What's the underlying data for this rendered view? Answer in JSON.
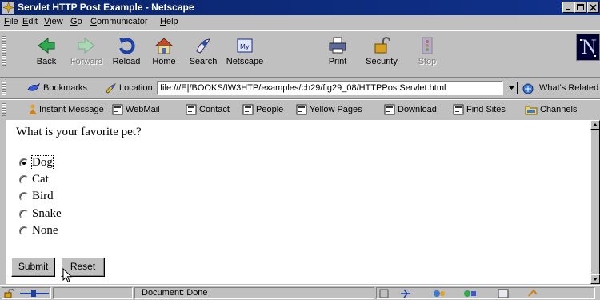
{
  "window": {
    "title": "Servlet HTTP Post Example - Netscape",
    "icon": "netscape-star-icon"
  },
  "menu": {
    "items": [
      {
        "label": "File",
        "accel": "F",
        "rest": "ile"
      },
      {
        "label": "Edit",
        "accel": "E",
        "rest": "dit"
      },
      {
        "label": "View",
        "accel": "V",
        "rest": "iew"
      },
      {
        "label": "Go",
        "accel": "G",
        "rest": "o"
      },
      {
        "label": "Communicator",
        "accel": "C",
        "rest": "ommunicator"
      },
      {
        "label": "Help",
        "accel": "H",
        "rest": "elp"
      }
    ]
  },
  "toolbar": {
    "back": "Back",
    "forward": "Forward",
    "reload": "Reload",
    "home": "Home",
    "search": "Search",
    "netscape": "Netscape",
    "print": "Print",
    "security": "Security",
    "stop": "Stop"
  },
  "location_bar": {
    "bookmarks": "Bookmarks",
    "location_label": "Location:",
    "url": "file:///E|/BOOKS/IW3HTP/examples/ch29/fig29_08/HTTPPostServlet.html",
    "whats_related": "What's Related"
  },
  "personal_toolbar": {
    "items": [
      "Instant Message",
      "WebMail",
      "Contact",
      "People",
      "Yellow Pages",
      "Download",
      "Find Sites",
      "Channels"
    ]
  },
  "page": {
    "question": "What is your favorite pet?",
    "options": [
      {
        "label": "Dog",
        "checked": true
      },
      {
        "label": "Cat",
        "checked": false
      },
      {
        "label": "Bird",
        "checked": false
      },
      {
        "label": "Snake",
        "checked": false
      },
      {
        "label": "None",
        "checked": false
      }
    ],
    "submit": "Submit",
    "reset": "Reset"
  },
  "status": {
    "text": "Document: Done"
  },
  "colors": {
    "titlebar": "#0a246a",
    "chrome": "#c0c0c0",
    "content_bg": "#ffffff"
  }
}
